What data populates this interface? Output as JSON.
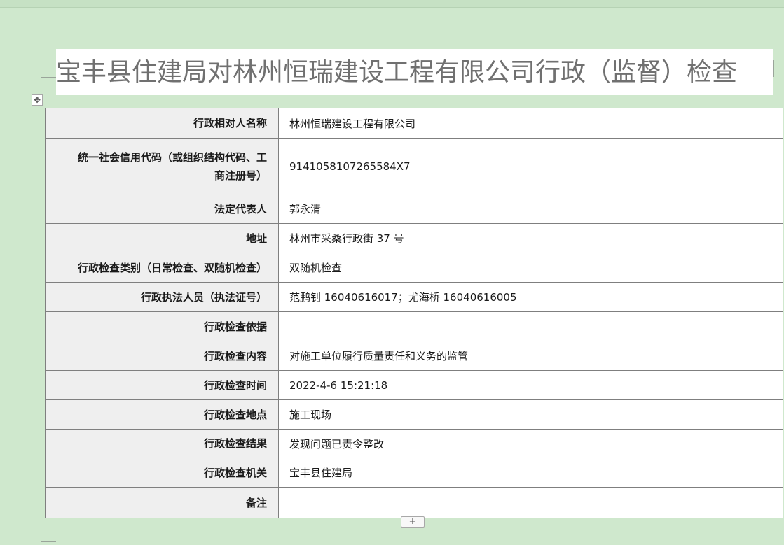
{
  "document": {
    "title": "宝丰县住建局对林州恒瑞建设工程有限公司行政（监督）检查"
  },
  "table": {
    "rows": [
      {
        "label": "行政相对人名称",
        "value": "林州恒瑞建设工程有限公司"
      },
      {
        "label_line1": "统一社会信用代码（或组织结构代码、工",
        "label_line2": "商注册号）",
        "value": "9141058107265584X7"
      },
      {
        "label": "法定代表人",
        "value": "郭永清"
      },
      {
        "label": "地址",
        "value": "林州市采桑行政街 37 号"
      },
      {
        "label": "行政检查类别（日常检查、双随机检查）",
        "value": "双随机检查"
      },
      {
        "label": "行政执法人员（执法证号）",
        "value": "范鹏钊 16040616017；尤海桥 16040616005"
      },
      {
        "label": "行政检查依据",
        "value": ""
      },
      {
        "label": "行政检查内容",
        "value": "对施工单位履行质量责任和义务的监管"
      },
      {
        "label": "行政检查时间",
        "value": "2022-4-6 15:21:18"
      },
      {
        "label": "行政检查地点",
        "value": "施工现场"
      },
      {
        "label": "行政检查结果",
        "value": "发现问题已责令整改"
      },
      {
        "label": "行政检查机关",
        "value": "宝丰县住建局"
      },
      {
        "label": "备注",
        "value": ""
      }
    ]
  },
  "controls": {
    "move_handle_glyph": "✥",
    "add_row_glyph": "+"
  }
}
